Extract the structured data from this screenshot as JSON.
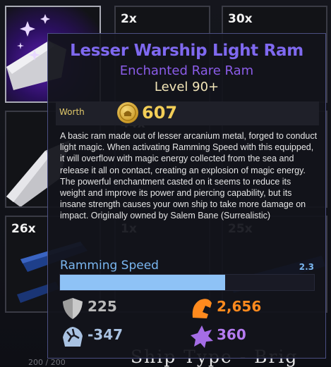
{
  "grid": {
    "slots": [
      {
        "qty": ""
      },
      {
        "qty": "2x"
      },
      {
        "qty": "30x"
      },
      {
        "qty": ""
      },
      {
        "qty": "44x"
      },
      {
        "qty": ""
      },
      {
        "qty": "26x"
      },
      {
        "qty": "1x"
      },
      {
        "qty": "25x"
      }
    ],
    "bottom_text": "Ship Type - Brig",
    "bottom_small": "200 / 200"
  },
  "tooltip": {
    "title": "Lesser Warship Light Ram",
    "subtitle": "Enchanted Rare Ram",
    "level": "Level 90+",
    "worth_label": "Worth",
    "worth_value": "607",
    "description": "A basic ram made out of lesser arcanium metal, forged to conduct light magic. When activating Ramming Speed with this equipped, it will overflow with magic energy collected from the sea and release it all on contact, creating an explosion of magic energy. The powerful enchantment casted on it seems to reduce its weight and improve its power and piercing capability, but its insane strength causes your own ship to take more damage on impact. Originally owned by Salem Bane (Surrealistic)",
    "stat_bar": {
      "label": "Ramming Speed",
      "value": "2.3",
      "fill_fraction": 0.65
    },
    "stats": [
      {
        "icon": "shield-icon",
        "value": "225",
        "color": "#b9b9b9"
      },
      {
        "icon": "fist-icon",
        "value": "2,656",
        "color": "#ff8a1e"
      },
      {
        "icon": "cracked-armor-icon",
        "value": "-347",
        "color": "#a9c2e2"
      },
      {
        "icon": "burst-star-icon",
        "value": "360",
        "color": "#b57bf0"
      }
    ]
  },
  "colors": {
    "title": "#7f69f0",
    "subtitle": "#8b5ce8",
    "level": "#f3e6b8",
    "worth": "#f3ce57",
    "bar_fill": "#8ec2f6"
  }
}
